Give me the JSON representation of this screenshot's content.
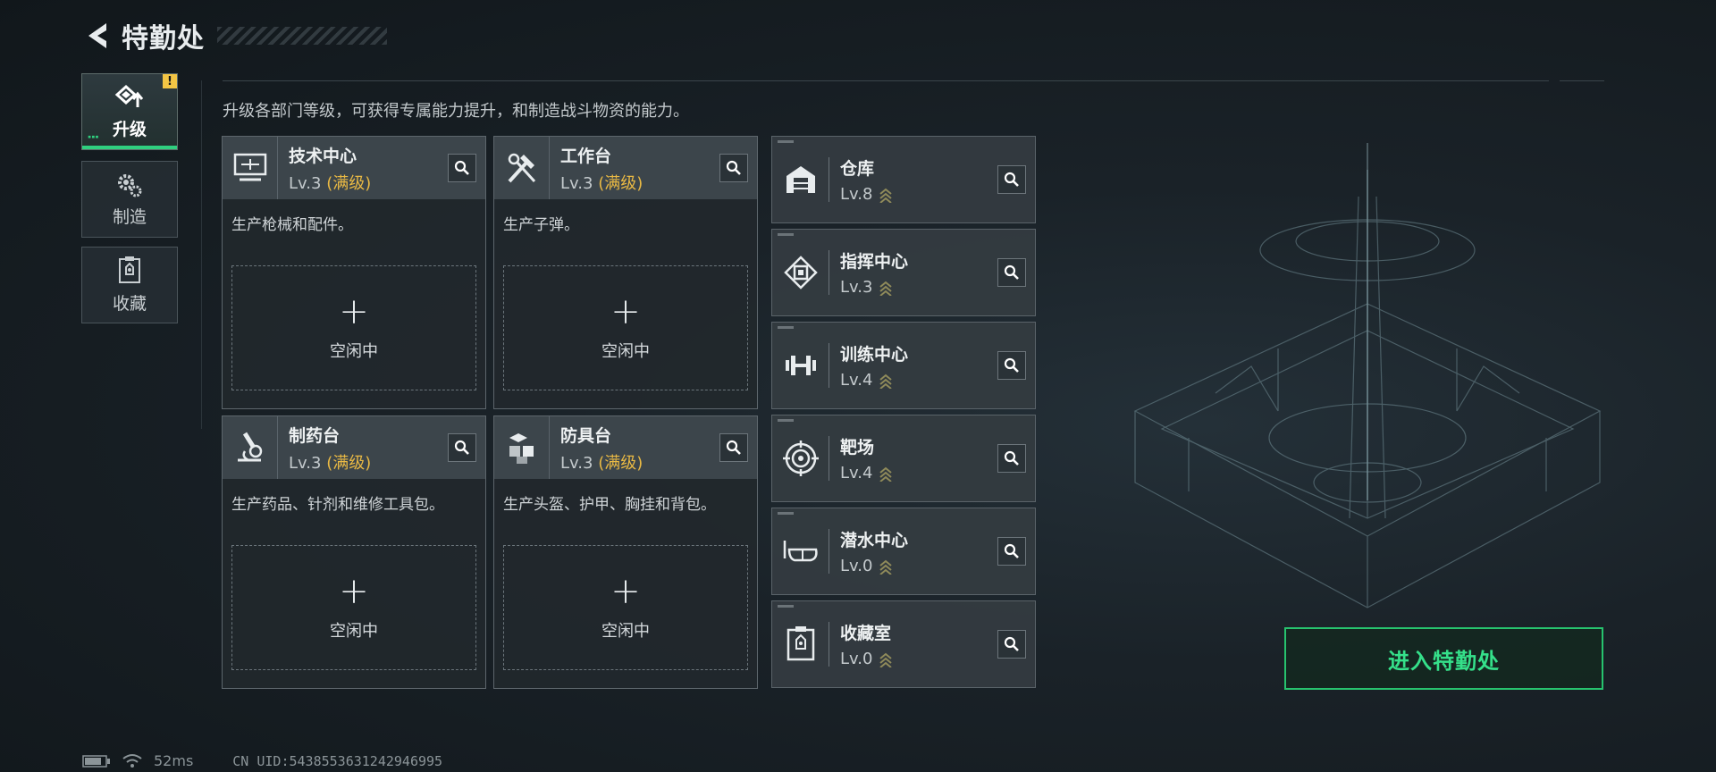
{
  "header": {
    "title": "特勤处"
  },
  "sidebar": {
    "items": [
      {
        "label": "升级",
        "icon": "upgrade-icon",
        "active": true,
        "alert": "!"
      },
      {
        "label": "制造",
        "icon": "gears-icon",
        "active": false
      },
      {
        "label": "收藏",
        "icon": "collection-icon",
        "active": false
      }
    ]
  },
  "description": "升级各部门等级，可获得专属能力提升，和制造战斗物资的能力。",
  "production": [
    {
      "name": "技术中心",
      "level": "Lv.3",
      "status": "(满级)",
      "desc": "生产枪械和配件。",
      "slot_plus": "+",
      "slot_label": "空闲中",
      "icon": "computer-icon"
    },
    {
      "name": "工作台",
      "level": "Lv.3",
      "status": "(满级)",
      "desc": "生产子弹。",
      "slot_plus": "+",
      "slot_label": "空闲中",
      "icon": "tools-icon"
    },
    {
      "name": "制药台",
      "level": "Lv.3",
      "status": "(满级)",
      "desc": "生产药品、针剂和维修工具包。",
      "slot_plus": "+",
      "slot_label": "空闲中",
      "icon": "microscope-icon"
    },
    {
      "name": "防具台",
      "level": "Lv.3",
      "status": "(满级)",
      "desc": "生产头盔、护甲、胸挂和背包。",
      "slot_plus": "+",
      "slot_label": "空闲中",
      "icon": "boxes-icon"
    }
  ],
  "facilities": [
    {
      "name": "仓库",
      "level": "Lv.8",
      "icon": "warehouse-icon"
    },
    {
      "name": "指挥中心",
      "level": "Lv.3",
      "icon": "chip-icon"
    },
    {
      "name": "训练中心",
      "level": "Lv.4",
      "icon": "dumbbell-icon"
    },
    {
      "name": "靶场",
      "level": "Lv.4",
      "icon": "target-icon"
    },
    {
      "name": "潜水中心",
      "level": "Lv.0",
      "icon": "diving-mask-icon"
    },
    {
      "name": "收藏室",
      "level": "Lv.0",
      "icon": "collection-room-icon"
    }
  ],
  "enter_button": "进入特勤处",
  "footer": {
    "ping": "52ms",
    "uid": "CN UID:5438553631242946995"
  },
  "colors": {
    "accent": "#2fd07f",
    "maxed": "#e9b944",
    "alert": "#f3c544"
  }
}
